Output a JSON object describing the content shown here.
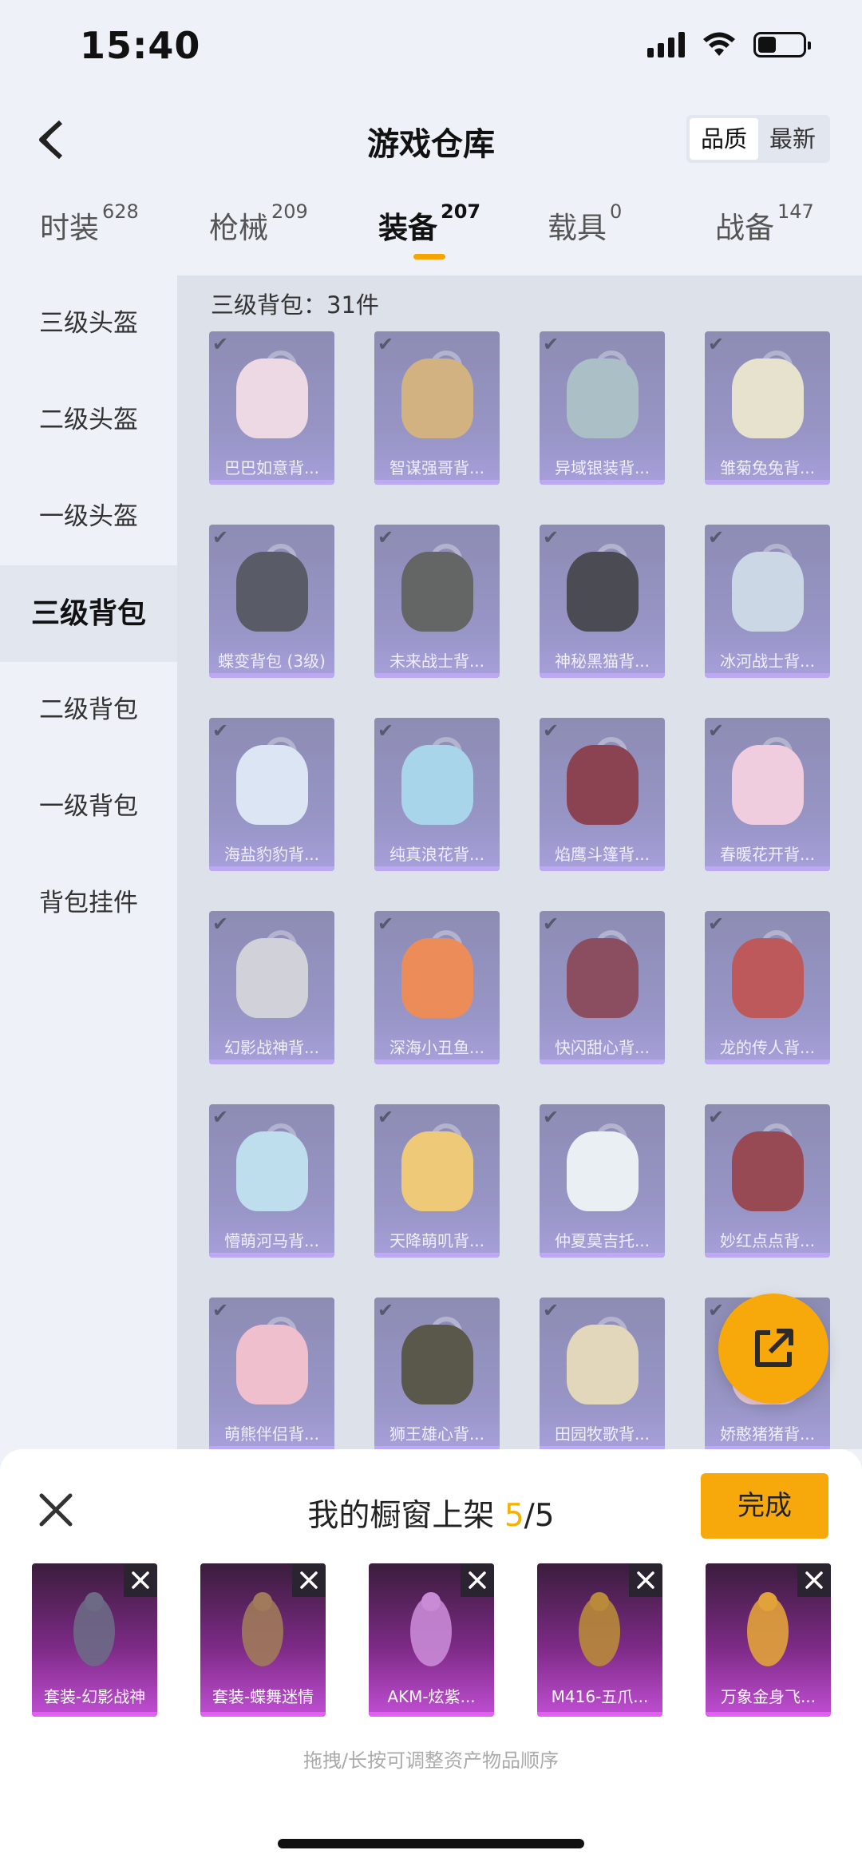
{
  "status_bar": {
    "time": "15:40"
  },
  "header": {
    "title": "游戏仓库",
    "sort_options": [
      "品质",
      "最新"
    ],
    "active_sort": "品质"
  },
  "tabs": [
    {
      "label": "时装",
      "count": "628"
    },
    {
      "label": "枪械",
      "count": "209"
    },
    {
      "label": "装备",
      "count": "207"
    },
    {
      "label": "载具",
      "count": "0"
    },
    {
      "label": "战备",
      "count": "147"
    }
  ],
  "sidebar": {
    "items": [
      "三级头盔",
      "二级头盔",
      "一级头盔",
      "三级背包",
      "二级背包",
      "一级背包",
      "背包挂件"
    ],
    "active": "三级背包"
  },
  "content": {
    "title": "三级背包：31件",
    "items": [
      {
        "name": "巴巴如意背...",
        "color": "#f1d8e2"
      },
      {
        "name": "智谋强哥背...",
        "color": "#d2a86a"
      },
      {
        "name": "异域银装背...",
        "color": "#9fb8bf"
      },
      {
        "name": "雏菊兔兔背...",
        "color": "#e9e3c9"
      },
      {
        "name": "蝶变背包 (3级)",
        "color": "#3d3f4a"
      },
      {
        "name": "未来战士背...",
        "color": "#4a4a48"
      },
      {
        "name": "神秘黑猫背...",
        "color": "#2b2b33"
      },
      {
        "name": "冰河战士背...",
        "color": "#c9d6e6"
      },
      {
        "name": "海盐豹豹背...",
        "color": "#dbe6f6"
      },
      {
        "name": "纯真浪花背...",
        "color": "#9ed3ea"
      },
      {
        "name": "焰鹰斗篷背...",
        "color": "#7a2030"
      },
      {
        "name": "春暖花开背...",
        "color": "#f3c8dc"
      },
      {
        "name": "幻影战神背...",
        "color": "#cfcfd6"
      },
      {
        "name": "深海小丑鱼...",
        "color": "#ef7a3a"
      },
      {
        "name": "快闪甜心背...",
        "color": "#7a2e44"
      },
      {
        "name": "龙的传人背...",
        "color": "#b83c3c"
      },
      {
        "name": "懵萌河马背...",
        "color": "#b8def0"
      },
      {
        "name": "天降萌叽背...",
        "color": "#f2c660"
      },
      {
        "name": "仲夏莫吉托...",
        "color": "#eef3f6"
      },
      {
        "name": "妙红点点背...",
        "color": "#8a2a34"
      },
      {
        "name": "萌熊伴侣背...",
        "color": "#f3b8c8"
      },
      {
        "name": "狮王雄心背...",
        "color": "#3e3a28"
      },
      {
        "name": "田园牧歌背...",
        "color": "#e4d6b0"
      },
      {
        "name": "娇憨猪猪背...",
        "color": "#f2c4d2"
      }
    ]
  },
  "sheet": {
    "title_prefix": "我的橱窗上架 ",
    "count_current": "5",
    "count_total": "/5",
    "done_label": "完成",
    "hint": "拖拽/长按可调整资产物品顺序",
    "items": [
      {
        "name": "套装-幻影战神",
        "color": "#6d6a86"
      },
      {
        "name": "套装-蝶舞迷情",
        "color": "#a07a5a"
      },
      {
        "name": "AKM-炫紫...",
        "color": "#c98ad6"
      },
      {
        "name": "M416-五爪...",
        "color": "#b88a3a"
      },
      {
        "name": "万象金身飞...",
        "color": "#e2a23a"
      }
    ]
  },
  "colors": {
    "accent": "#f7a90c",
    "count_highlight": "#f5b000"
  }
}
